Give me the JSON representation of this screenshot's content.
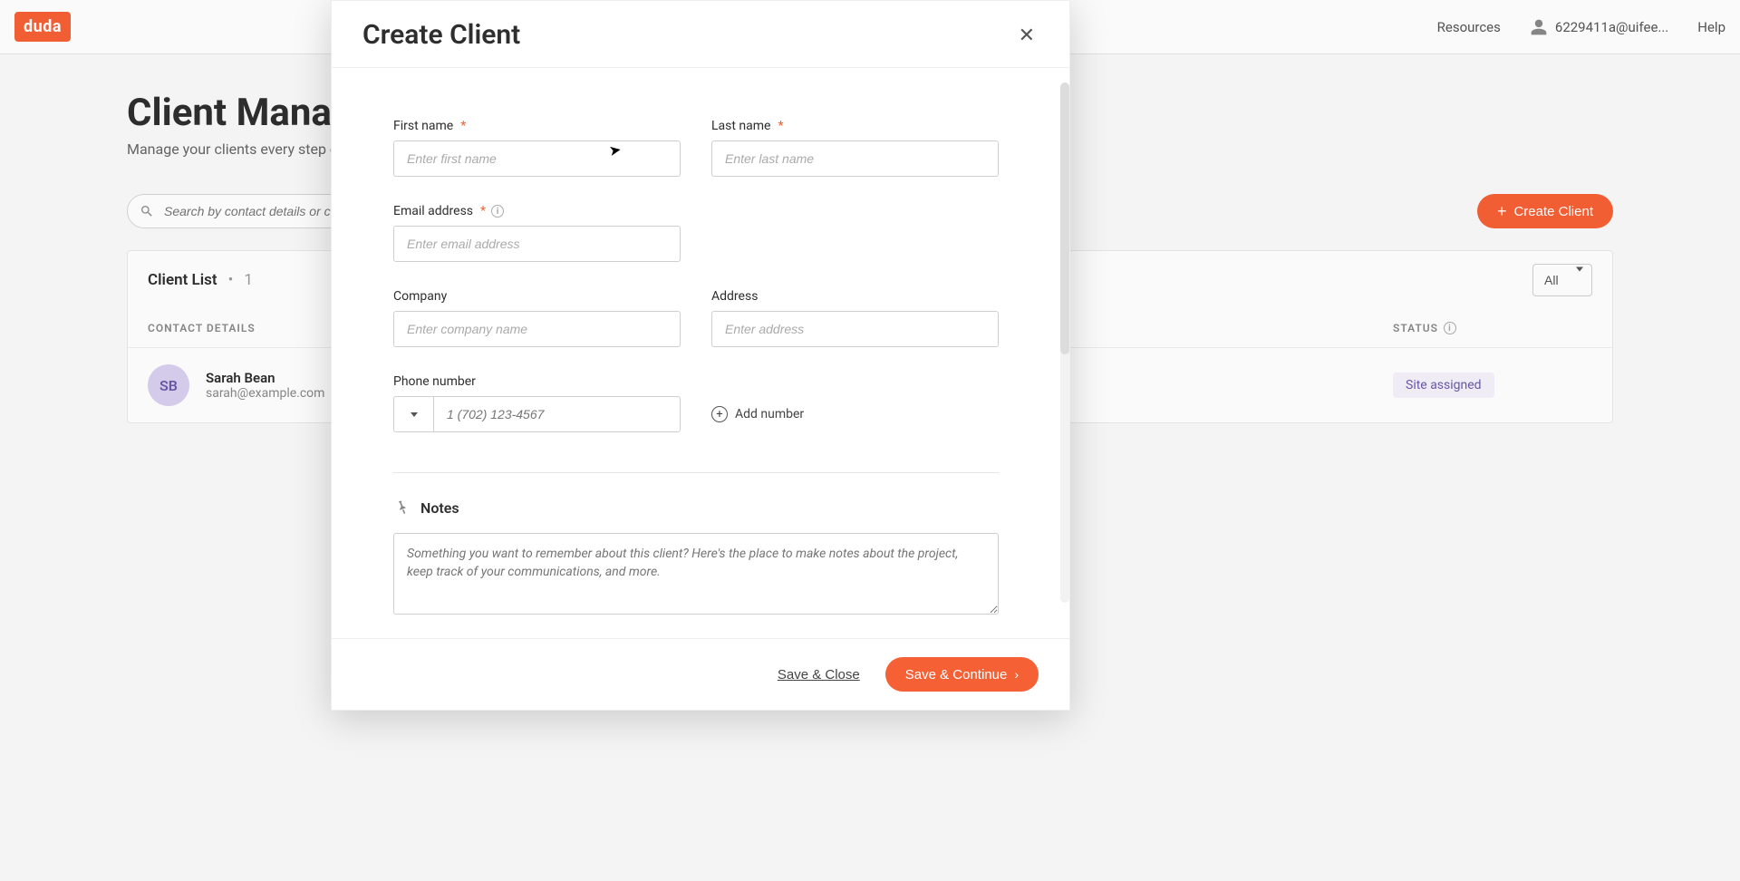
{
  "header": {
    "logo_text": "duda",
    "resources_label": "Resources",
    "account_email": "6229411a@uifee...",
    "help_label": "Help"
  },
  "page": {
    "title": "Client Management",
    "subtitle": "Manage your clients every step of the way."
  },
  "toolbar": {
    "search_placeholder": "Search by contact details or company name",
    "create_client_label": "Create Client"
  },
  "list": {
    "title": "Client List",
    "separator": "•",
    "count": "1",
    "filter_value": "All",
    "columns": {
      "contact": "CONTACT DETAILS",
      "status": "STATUS"
    },
    "rows": [
      {
        "initials": "SB",
        "name": "Sarah Bean",
        "email": "sarah@example.com",
        "status": "Site assigned"
      }
    ]
  },
  "modal": {
    "title": "Create Client",
    "labels": {
      "first_name": "First name",
      "last_name": "Last name",
      "email": "Email address",
      "company": "Company",
      "address": "Address",
      "phone": "Phone number",
      "add_number": "Add number",
      "notes_header": "Notes"
    },
    "placeholders": {
      "first_name": "Enter first name",
      "last_name": "Enter last name",
      "email": "Enter email address",
      "company": "Enter company name",
      "address": "Enter address",
      "phone": "1 (702) 123-4567",
      "notes": "Something you want to remember about this client? Here's the place to make notes about the project, keep track of your communications, and more."
    },
    "footer": {
      "save_close": "Save & Close",
      "save_continue": "Save & Continue"
    }
  }
}
